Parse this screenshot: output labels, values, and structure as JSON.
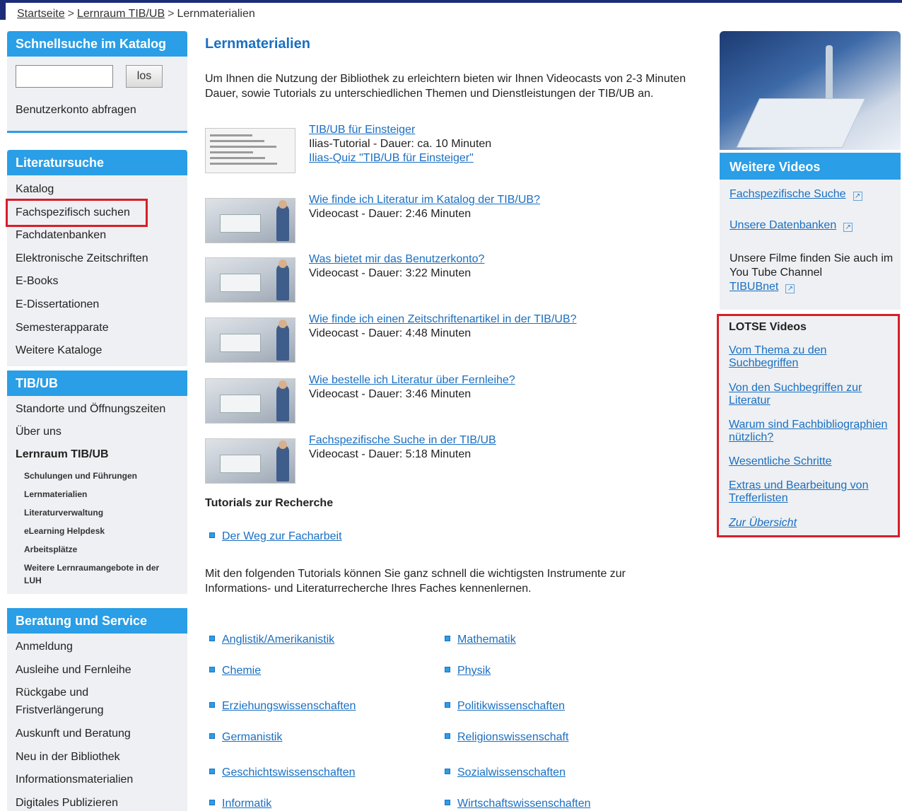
{
  "breadcrumb": {
    "home": "Startseite",
    "lernraum": "Lernraum TIB/UB",
    "current": "Lernmaterialien",
    "separator": ">"
  },
  "sidebar": {
    "quicksearch": {
      "title": "Schnellsuche im Katalog",
      "search_value": "",
      "button_label": "los",
      "account_link": "Benutzerkonto abfragen"
    },
    "literatursuche": {
      "title": "Literatursuche",
      "items": [
        "Katalog",
        "Fachspezifisch suchen",
        "Fachdatenbanken",
        "Elektronische Zeitschriften",
        "E-Books",
        "E-Dissertationen",
        "Semesterapparate",
        "Weitere Kataloge"
      ]
    },
    "tibub": {
      "title": "TIB/UB",
      "items": [
        "Standorte und Öffnungszeiten",
        "Über uns",
        "Lernraum TIB/UB"
      ],
      "subitems": [
        "Schulungen und Führungen",
        "Lernmaterialien",
        "Literaturverwaltung",
        "eLearning Helpdesk",
        "Arbeitsplätze",
        "Weitere Lernraumangebote in der",
        "LUH"
      ]
    },
    "beratung": {
      "title": "Beratung und Service",
      "items": [
        "Anmeldung",
        "Ausleihe und Fernleihe",
        "Rückgabe und",
        "Fristverlängerung",
        "Auskunft und Beratung",
        "Neu in der Bibliothek",
        "Informationsmaterialien",
        "Digitales Publizieren"
      ]
    }
  },
  "main": {
    "title": "Lernmaterialien",
    "intro": "Um Ihnen die Nutzung der Bibliothek zu erleichtern bieten wir Ihnen Videocasts von 2-3 Minuten Dauer, sowie Tutorials zu unterschiedlichen Themen und Dienstleistungen der TIB/UB an.",
    "media": [
      {
        "link": "TIB/UB für Einsteiger",
        "desc": "Ilias-Tutorial - Dauer: ca. 10 Minuten",
        "link2": "Ilias-Quiz \"TIB/UB für Einsteiger\""
      },
      {
        "link": "Wie finde ich Literatur im Katalog der TIB/UB?",
        "desc": "Videocast - Dauer: 2:46 Minuten"
      },
      {
        "link": "Was bietet mir das Benutzerkonto?",
        "desc": "Videocast - Dauer: 3:22 Minuten"
      },
      {
        "link": "Wie finde ich einen Zeitschriftenartikel in der TIB/UB?",
        "desc": "Videocast - Dauer: 4:48 Minuten"
      },
      {
        "link": "Wie bestelle ich Literatur über Fernleihe?",
        "desc": "Videocast - Dauer: 3:46 Minuten"
      },
      {
        "link": "Fachspezifische Suche in der TIB/UB",
        "desc": "Videocast - Dauer: 5:18 Minuten"
      }
    ],
    "tutorials_heading": "Tutorials zur Recherche",
    "tutorial_link": "Der Weg zur Facharbeit",
    "tutorials_text": "Mit den folgenden Tutorials können Sie ganz schnell die wichtigsten Instrumente zur Informations- und Literaturrecherche Ihres Faches kennenlernen.",
    "subjects_left": [
      "Anglistik/Amerikanistik",
      "Chemie",
      "Erziehungswissenschaften",
      "Germanistik",
      "Geschichtswissenschaften",
      "Informatik"
    ],
    "subjects_right": [
      "Mathematik",
      "Physik",
      "Politikwissenschaften",
      "Religionswissenschaft",
      "Sozialwissenschaften",
      "Wirtschaftswissenschaften"
    ]
  },
  "right": {
    "videos_title": "Weitere Videos",
    "links": [
      "Fachspezifische Suche",
      "Unsere Datenbanken"
    ],
    "youtube_text": "Unsere Filme finden Sie auch im You Tube Channel",
    "youtube_link": "TIBUBnet",
    "ext_icon": "↗",
    "lotse": {
      "title": "LOTSE Videos",
      "links": [
        "Vom Thema zu den Suchbegriffen",
        "Von den Suchbegriffen zur Literatur",
        "Warum sind Fachbibliographien nützlich?",
        "Wesentliche Schritte",
        "Extras und Bearbeitung von Trefferlisten",
        "Zur Übersicht"
      ]
    }
  },
  "colors": {
    "accent": "#2a9ee6",
    "link": "#1a6fc1",
    "highlight": "#d81e2a",
    "sidebar_bg": "#eef0f3"
  }
}
